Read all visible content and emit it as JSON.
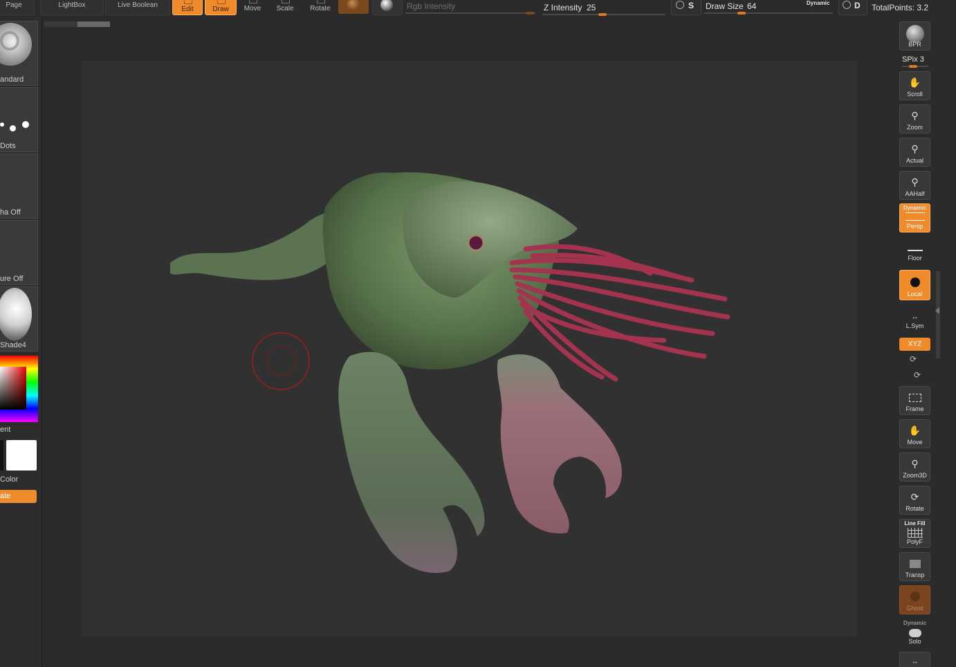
{
  "toolbar": {
    "page_label": "Page",
    "lightbox_label": "LightBox",
    "live_boolean_label": "Live Boolean",
    "edit_label": "Edit",
    "draw_label": "Draw",
    "move_label": "Move",
    "scale_label": "Scale",
    "rotate_label": "Rotate",
    "rgb_intensity_label": "Rgb Intensity",
    "z_intensity_label": "Z Intensity",
    "z_intensity_value": "25",
    "s_label": "S",
    "draw_size_label": "Draw Size",
    "draw_size_value": "64",
    "dynamic_label": "Dynamic",
    "d_label": "D",
    "total_points_label": "TotalPoints: 3.2"
  },
  "left_panel": {
    "brush_label": "andard",
    "stroke_label": "Dots",
    "alpha_label": "ha Off",
    "texture_label": "ure Off",
    "material_label": "Shade4",
    "gradient_label": "ent",
    "color_label": "Color",
    "rotate_button_label": "ate"
  },
  "right_shelf": {
    "bpr_label": "BPR",
    "spix_label": "SPix",
    "spix_value": "3",
    "scroll_label": "Scroll",
    "zoom_label": "Zoom",
    "actual_label": "Actual",
    "aahalf_label": "AAHalf",
    "persp_top": "Dynamic",
    "persp_label": "Persp",
    "floor_label": "Floor",
    "local_label": "Local",
    "lsym_label": "L.Sym",
    "xyz_label": "XYZ",
    "frame_label": "Frame",
    "move_label": "Move",
    "zoom3d_label": "Zoom3D",
    "rotate_label": "Rotate",
    "polyf_top": "Line Fill",
    "polyf_label": "PolyF",
    "transp_label": "Transp",
    "ghost_label": "Ghost",
    "solo_top": "Dynamic",
    "solo_label": "Solo"
  },
  "colors": {
    "accent": "#f08b2c",
    "cursor_ring": "#b01818",
    "creature_green": "#5f7a52",
    "tentacle_red": "#a3334f",
    "claw_pink": "#9a6d73"
  },
  "sliders": {
    "z_intensity_fraction": 0.25,
    "draw_size_fraction": 0.26
  }
}
